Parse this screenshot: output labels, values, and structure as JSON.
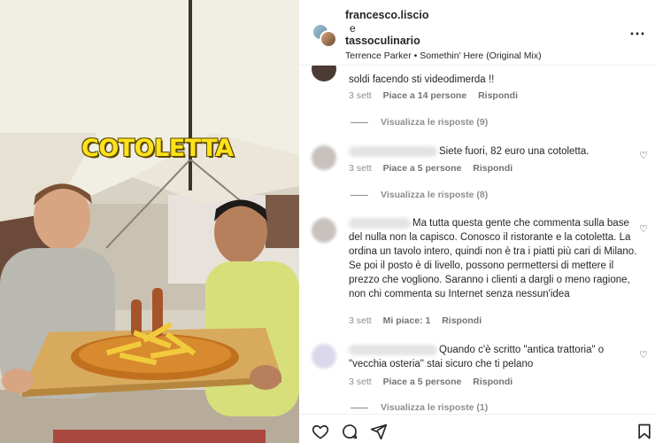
{
  "media": {
    "overlay_text": "COTOLETTA"
  },
  "header": {
    "user1": "francesco.liscio",
    "conjunction": "e",
    "user2": "tassoculinario",
    "music_artist": "Terrence Parker",
    "music_separator": "•",
    "music_track": "Somethin' Here (Original Mix)",
    "more_icon": "⋯"
  },
  "comments": [
    {
      "text": "soldi facendo sti videodimerda !!",
      "date": "3 sett",
      "likes": "Piace a 14 persone",
      "reply": "Rispondi",
      "view_replies": "Visualizza le risposte (9)"
    },
    {
      "text": "Siete fuori, 82 euro una cotoletta.",
      "date": "3 sett",
      "likes": "Piace a 5 persone",
      "reply": "Rispondi",
      "view_replies": "Visualizza le risposte (8)"
    },
    {
      "text": "Ma tutta questa gente che commenta sulla base del nulla non la capisco. Conosco il ristorante e la cotoletta. La ordina un tavolo intero, quindi non è tra i piatti più cari di Milano. Se poi il posto è di livello, possono permettersi di mettere il prezzo che vogliono. Saranno i clienti a dargli o meno ragione, non chi commenta su Internet senza nessun'idea",
      "date": "3 sett",
      "likes": "Mi piace: 1",
      "reply": "Rispondi"
    },
    {
      "text": "Quando c'è scritto \"antica trattoria\" o \"vecchia osteria\" stai sicuro che ti pelano",
      "date": "3 sett",
      "likes": "Piace a 5 persone",
      "reply": "Rispondi",
      "view_replies": "Visualizza le risposte (1)"
    }
  ],
  "icons": {
    "heart": "♡",
    "like_action": "heart-icon",
    "comment_action": "comment-icon",
    "share_action": "send-icon",
    "save_action": "bookmark-icon"
  }
}
